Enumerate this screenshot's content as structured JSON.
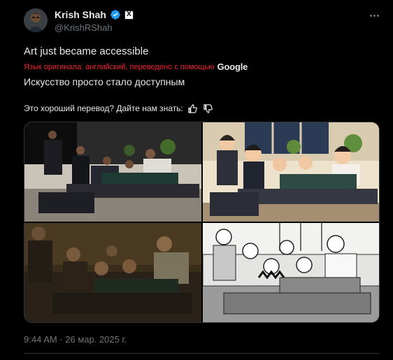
{
  "author": {
    "name": "Krish Shah",
    "handle": "@KrishRShah",
    "verified": true,
    "badge_label": "X"
  },
  "tweet": {
    "text": "Art just became accessible",
    "translation_note": "Язык оригинала: английский, переведено с помощью",
    "translator_logo": "Google",
    "translated_text": "Искусство просто стало доступным",
    "feedback_question": "Это хороший перевод? Дайте нам знать:",
    "timestamp": "9:44 AM · 26 мар. 2025 г."
  },
  "icons": [
    "verified-icon",
    "more-icon",
    "thumbs-up-icon",
    "thumbs-down-icon"
  ],
  "colors": {
    "background": "#000000",
    "primary_text": "#e7e9ea",
    "secondary_text": "#71767b",
    "verified": "#1d9bf0",
    "translation_note": "#f4212e",
    "border": "#2f3336"
  },
  "media": [
    {
      "name": "photo",
      "style": "original photo"
    },
    {
      "name": "anime",
      "style": "anime illustration"
    },
    {
      "name": "painting",
      "style": "oil painting"
    },
    {
      "name": "lineart",
      "style": "black and white line art"
    }
  ]
}
